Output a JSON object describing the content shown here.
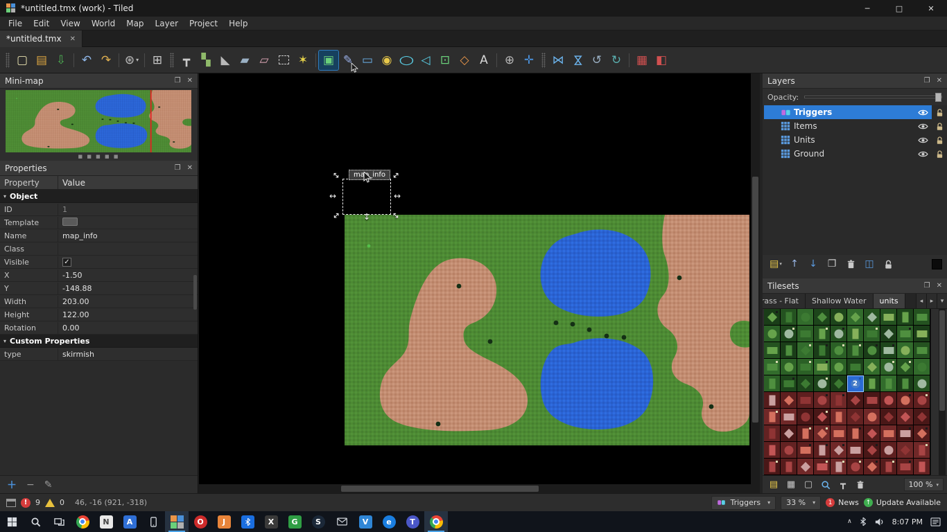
{
  "window": {
    "title": "*untitled.tmx (work) - Tiled",
    "controls": [
      {
        "name": "minimize",
        "glyph": "─"
      },
      {
        "name": "maximize",
        "glyph": "□"
      },
      {
        "name": "close",
        "glyph": "✕"
      }
    ]
  },
  "icons": {
    "close": "✕",
    "float": "❐",
    "caret_down": "▾",
    "caret_left": "◂",
    "caret_right": "▸",
    "chevron_up": "∧"
  },
  "colors": {
    "selection_blue": "#2d7cd6",
    "grass": "#4d8a33",
    "water": "#2a63d4",
    "land": "#c28c71"
  },
  "menu": {
    "items": [
      "File",
      "Edit",
      "View",
      "World",
      "Map",
      "Layer",
      "Project",
      "Help"
    ]
  },
  "tabs": [
    {
      "label": "*untitled.tmx",
      "active": true
    }
  ],
  "toolbar": {
    "items": [
      {
        "grip": true
      },
      {
        "name": "new-file",
        "glyph": "▢",
        "color": "#e8e2b0"
      },
      {
        "name": "open-file",
        "glyph": "▤",
        "color": "#d9a441"
      },
      {
        "name": "save-file",
        "glyph": "⇩",
        "color": "#4db052"
      },
      {
        "sep": true
      },
      {
        "name": "undo",
        "glyph": "↶",
        "color": "#8fb7e8"
      },
      {
        "name": "redo",
        "glyph": "↷",
        "color": "#e0b050"
      },
      {
        "sep": true
      },
      {
        "name": "views-and-toolbars",
        "glyph": "⊛",
        "color": "#c0c0c0",
        "caret": true
      },
      {
        "sep": true
      },
      {
        "name": "tile-stamps",
        "glyph": "⊞",
        "color": "#c9c9c9"
      },
      {
        "grip": true
      },
      {
        "name": "stamp-brush",
        "glyph": "┳",
        "color": "#c9c9c9"
      },
      {
        "name": "terrain-brush",
        "glyph": "▚",
        "color": "#8fba6a"
      },
      {
        "name": "bucket-fill",
        "glyph": "◣",
        "color": "#b8b8b8"
      },
      {
        "name": "shape-fill",
        "glyph": "▰",
        "color": "#9ab0c4"
      },
      {
        "name": "eraser",
        "glyph": "▱",
        "color": "#e0a8b8"
      },
      {
        "name": "rectangular-select",
        "dash": true
      },
      {
        "name": "magic-wand",
        "glyph": "✶",
        "color": "#e8d44a"
      },
      {
        "sep": true
      },
      {
        "name": "select-objects",
        "glyph": "▣",
        "color": "#6ad07a",
        "active": true
      },
      {
        "name": "edit-polygons",
        "glyph": "✎",
        "color": "#9ab0e8",
        "cursor": true
      },
      {
        "name": "insert-rectangle",
        "glyph": "▭",
        "color": "#6ab0e8"
      },
      {
        "name": "insert-point",
        "glyph": "◉",
        "color": "#e8c84a"
      },
      {
        "name": "insert-ellipse",
        "glyph": "○",
        "color": "#5ad0e8",
        "sx": true
      },
      {
        "name": "insert-polygon",
        "glyph": "◁",
        "color": "#5ad0e8"
      },
      {
        "name": "insert-tile",
        "glyph": "⊡",
        "color": "#6ad07a"
      },
      {
        "name": "insert-template",
        "glyph": "◇",
        "color": "#e8954a"
      },
      {
        "name": "insert-text",
        "glyph": "A",
        "color": "#d8d8d8"
      },
      {
        "sep": true
      },
      {
        "name": "world-tool",
        "glyph": "⊕",
        "color": "#b8b8b8"
      },
      {
        "name": "pan-tool",
        "glyph": "✛",
        "color": "#4a90d9"
      },
      {
        "grip": true
      },
      {
        "name": "flip-horizontal",
        "glyph": "⋈",
        "color": "#6ab0e8"
      },
      {
        "name": "flip-vertical",
        "glyph": "⋈",
        "color": "#6ab0e8",
        "rot": true
      },
      {
        "name": "rotate-left",
        "glyph": "↺",
        "color": "#9ab0c4"
      },
      {
        "name": "rotate-right",
        "glyph": "↻",
        "color": "#5ab0b0"
      },
      {
        "sep": true
      },
      {
        "name": "highlight-current-layer",
        "glyph": "▦",
        "color": "#d05050"
      },
      {
        "name": "show-tile-collisions",
        "glyph": "◧",
        "color": "#d05050"
      }
    ]
  },
  "minimap": {
    "title": "Mini-map"
  },
  "properties": {
    "title": "Properties",
    "columns": [
      "Property",
      "Value"
    ],
    "rows": [
      {
        "type": "group",
        "label": "Object"
      },
      {
        "property": "ID",
        "value": "1",
        "muted": true
      },
      {
        "property": "Template",
        "value": "",
        "template_box": true
      },
      {
        "property": "Name",
        "value": "map_info"
      },
      {
        "property": "Class",
        "value": ""
      },
      {
        "property": "Visible",
        "value": "checked",
        "checkbox": true
      },
      {
        "property": "X",
        "value": "-1.50"
      },
      {
        "property": "Y",
        "value": "-148.88"
      },
      {
        "property": "Width",
        "value": "203.00"
      },
      {
        "property": "Height",
        "value": "122.00"
      },
      {
        "property": "Rotation",
        "value": "0.00"
      },
      {
        "type": "group",
        "label": "Custom Properties"
      },
      {
        "property": "type",
        "value": "skirmish"
      }
    ]
  },
  "canvas": {
    "object_label": "map_info"
  },
  "layers_panel": {
    "title": "Layers",
    "opacity_label": "Opacity:",
    "layers": [
      {
        "name": "Triggers",
        "type": "object",
        "selected": true
      },
      {
        "name": "Items",
        "type": "tile"
      },
      {
        "name": "Units",
        "type": "tile"
      },
      {
        "name": "Ground",
        "type": "tile"
      }
    ],
    "toolbar": [
      {
        "name": "new-layer",
        "glyph": "▤",
        "color": "#e8c84a",
        "caret": true
      },
      {
        "name": "raise-layer",
        "glyph": "↑",
        "color": "#9ab8e8"
      },
      {
        "name": "lower-layer",
        "glyph": "↓",
        "color": "#5a9ade"
      },
      {
        "name": "duplicate-layer",
        "glyph": "❐",
        "color": "#c9c9c9"
      },
      {
        "name": "remove-layer",
        "svg": "trash",
        "color": "#c9c9c9"
      },
      {
        "name": "isolate-layers",
        "glyph": "◫",
        "color": "#5a9ade"
      },
      {
        "name": "lock-layers",
        "svg": "lock",
        "color": "#c9c9c9"
      }
    ]
  },
  "tilesets_panel": {
    "title": "Tilesets",
    "tabs": [
      {
        "label": "Grass - Flat"
      },
      {
        "label": "Shallow Water"
      },
      {
        "label": "units",
        "active": true
      }
    ],
    "toolbar": [
      {
        "name": "new-tileset",
        "glyph": "▤",
        "color": "#e8c84a"
      },
      {
        "name": "embed-tileset",
        "glyph": "▦",
        "color": "#c9c9c9"
      },
      {
        "name": "export-tileset",
        "glyph": "▢",
        "color": "#c9c9c9"
      },
      {
        "name": "edit-tileset",
        "svg": "zoom",
        "color": "#6ab0e8"
      },
      {
        "name": "stamp-from-selection",
        "glyph": "┳",
        "color": "#c9c9c9"
      },
      {
        "name": "remove-tileset",
        "svg": "trash",
        "color": "#c9c9c9"
      }
    ],
    "zoom": "100 %",
    "grid": {
      "cols": 10,
      "rows": 10,
      "green_rows": 5,
      "selected": {
        "row": 4,
        "col": 5,
        "label": "2"
      }
    }
  },
  "status_bar": {
    "error_count": "9",
    "warning_count": "0",
    "coordinates": "46, -16 (921, -318)",
    "layer_selector": "Triggers",
    "zoom": "33 %",
    "news_count": "1",
    "news_label": "News",
    "update_label": "Update Available"
  },
  "taskbar": {
    "time": "8:07 PM",
    "apps": [
      {
        "name": "start",
        "kind": "start"
      },
      {
        "name": "search",
        "kind": "search"
      },
      {
        "name": "task-view",
        "kind": "taskview"
      },
      {
        "name": "chrome",
        "kind": "chrome"
      },
      {
        "name": "notepad",
        "letter": "N",
        "bg": "#e9e9e9",
        "fg": "#444444"
      },
      {
        "name": "app-a",
        "letter": "A",
        "bg": "#2f6fd6"
      },
      {
        "name": "phone",
        "kind": "phone"
      },
      {
        "name": "tiled",
        "kind": "tiled",
        "active": true
      },
      {
        "name": "opera",
        "letter": "O",
        "bg": "#cc2b2b",
        "round": true
      },
      {
        "name": "app-orange",
        "letter": "J",
        "bg": "#e8843a"
      },
      {
        "name": "bluetooth",
        "kind": "bt"
      },
      {
        "name": "app-x",
        "letter": "X",
        "bg": "#3a3a3a"
      },
      {
        "name": "app-green",
        "letter": "G",
        "bg": "#2f9e44"
      },
      {
        "name": "steam",
        "letter": "S",
        "bg": "#1b2838",
        "round": true
      },
      {
        "name": "mail",
        "kind": "mail"
      },
      {
        "name": "vscode",
        "letter": "V",
        "bg": "#2f86d6"
      },
      {
        "name": "edge",
        "letter": "e",
        "bg": "#1a7ee0",
        "round": true
      },
      {
        "name": "teams",
        "letter": "T",
        "bg": "#4a57c8",
        "round": true
      },
      {
        "name": "chrome-2",
        "kind": "chrome",
        "active": true
      }
    ]
  }
}
